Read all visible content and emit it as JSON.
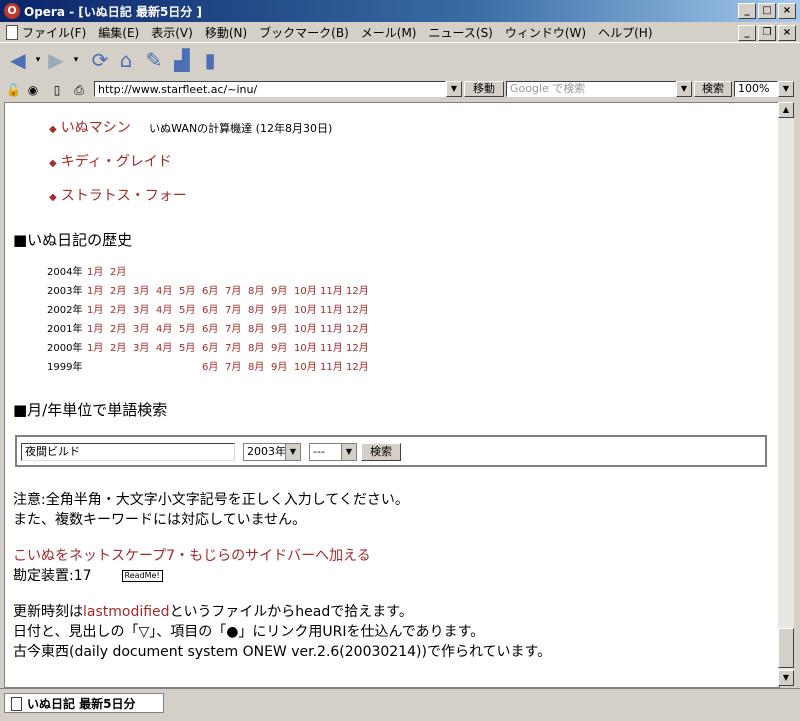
{
  "window": {
    "title": "Opera - [いぬ日記 最新5日分 ]",
    "app_icon": "opera-icon"
  },
  "menu": {
    "items": [
      "ファイル(F)",
      "編集(E)",
      "表示(V)",
      "移動(N)",
      "ブックマーク(B)",
      "メール(M)",
      "ニュース(S)",
      "ウィンドウ(W)",
      "ヘルプ(H)"
    ]
  },
  "address": {
    "url": "http://www.starfleet.ac/~inu/",
    "go_label": "移動",
    "search_placeholder": "Google で検索",
    "search_label": "検索",
    "zoom": "100%"
  },
  "page": {
    "links": [
      {
        "label": "いぬマシン",
        "note": "いぬWANの計算機達 (12年8月30日)"
      },
      {
        "label": "キディ・グレイド",
        "note": ""
      },
      {
        "label": "ストラトス・フォー",
        "note": ""
      }
    ],
    "history_heading": "■いぬ日記の歴史",
    "history": [
      {
        "year": "2004年",
        "months": [
          "1月",
          "2月",
          "",
          "",
          "",
          "",
          "",
          "",
          "",
          "",
          "",
          ""
        ]
      },
      {
        "year": "2003年",
        "months": [
          "1月",
          "2月",
          "3月",
          "4月",
          "5月",
          "6月",
          "7月",
          "8月",
          "9月",
          "10月",
          "11月",
          "12月"
        ]
      },
      {
        "year": "2002年",
        "months": [
          "1月",
          "2月",
          "3月",
          "4月",
          "5月",
          "6月",
          "7月",
          "8月",
          "9月",
          "10月",
          "11月",
          "12月"
        ]
      },
      {
        "year": "2001年",
        "months": [
          "1月",
          "2月",
          "3月",
          "4月",
          "5月",
          "6月",
          "7月",
          "8月",
          "9月",
          "10月",
          "11月",
          "12月"
        ]
      },
      {
        "year": "2000年",
        "months": [
          "1月",
          "2月",
          "3月",
          "4月",
          "5月",
          "6月",
          "7月",
          "8月",
          "9月",
          "10月",
          "11月",
          "12月"
        ]
      },
      {
        "year": "1999年",
        "months": [
          "",
          "",
          "",
          "",
          "",
          "6月",
          "7月",
          "8月",
          "9月",
          "10月",
          "11月",
          "12月"
        ]
      }
    ],
    "search_heading": "■月/年単位で単語検索",
    "search_form": {
      "keyword": "夜間ビルド",
      "year": "2003年",
      "month": "---",
      "submit": "検索"
    },
    "note_line1": "注意:全角半角・大文字小文字記号を正しく入力してください。",
    "note_line2": "また、複数キーワードには対応していません。",
    "sidebar_link": "こいぬをネットスケープ7・もじらのサイドバーへ加える",
    "counter_label": "勘定装置:17",
    "readme_label": "ReadMe!",
    "update_line_pre": "更新時刻は",
    "update_line_link": "lastmodified",
    "update_line_post": "というファイルからheadで拾えます。",
    "info_line2": "日付と、見出しの「▽」、項目の「●」にリンク用URIを仕込んであります。",
    "info_line3": "古今東西(daily document system ONEW ver.2.6(20030214))で作られています。"
  },
  "status": {
    "tab_title": "いぬ日記 最新5日分"
  },
  "colors": {
    "link": "#a52a2a",
    "chrome": "#d4d0c8",
    "titlebar": "#0a246a"
  }
}
